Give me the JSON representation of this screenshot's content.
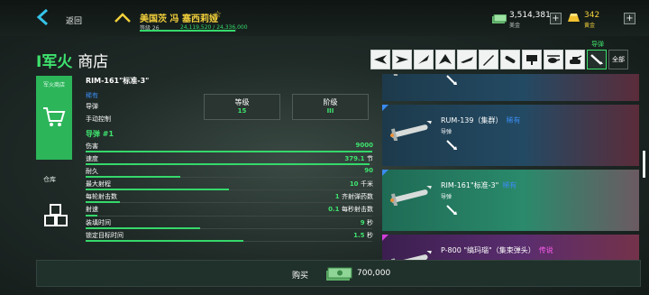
{
  "topbar": {
    "back_label": "返回",
    "player_name": "美国茨 冯 塞西莉娅",
    "level_label": "等级 26",
    "xp_text": "24,119,520 / 24,336,000",
    "xp_progress": 0.991,
    "cash_value": "3,514,381",
    "cash_label": "美金",
    "gold_value": "342",
    "gold_label": "黄金",
    "plus_label": "+"
  },
  "page": {
    "title_accent": "I军火",
    "title_main": "商店"
  },
  "categories": {
    "active_label": "导弹",
    "all_label": "全部",
    "icons": [
      "fighter-jet-icon",
      "strike-jet-icon",
      "interceptor-icon",
      "stealth-jet-icon",
      "bomber-icon",
      "rocket-icon",
      "missile-icon",
      "radar-icon",
      "helicopter-icon",
      "tank-icon",
      "missile-selected-icon"
    ]
  },
  "side_nav": {
    "shop_label": "军火商店",
    "store_label": "仓库"
  },
  "detail": {
    "item_name": "RIM-161\"标准-3\"",
    "rarity": "稀有",
    "type": "导弹",
    "control": "手动控制",
    "guided_label": "导弹 #1",
    "level_label": "等级",
    "level_value": "15",
    "tier_label": "阶级",
    "tier_value": "III"
  },
  "stats": [
    {
      "name": "伤害",
      "value": "9000",
      "unit": "",
      "level": 1.0
    },
    {
      "name": "速度",
      "value": "379.1",
      "unit": "节",
      "level": 0.99
    },
    {
      "name": "耐久",
      "value": "90",
      "unit": "",
      "level": 0.33
    },
    {
      "name": "最大射程",
      "value": "10",
      "unit": "千米",
      "level": 0.5
    },
    {
      "name": "每轮射击数",
      "value": "1",
      "unit": "齐射弹药数",
      "level": 0.12
    },
    {
      "name": "射速",
      "value": "0.1",
      "unit": "每秒射击数",
      "level": 0.04
    },
    {
      "name": "装填时间",
      "value": "9",
      "unit": "秒",
      "level": 0.4
    },
    {
      "name": "锁定目标时间",
      "value": "1.5",
      "unit": "秒",
      "level": 0.55
    }
  ],
  "list": [
    {
      "name": "",
      "rarity": "",
      "type": "",
      "variant": "partial"
    },
    {
      "name": "RUM-139（集群）",
      "rarity": "稀有",
      "type": "导弹",
      "variant": "normal"
    },
    {
      "name": "RIM-161\"标准-3\"",
      "rarity": "稀有",
      "type": "导弹",
      "variant": "selected"
    },
    {
      "name": "P-800 \"缟玛瑙\"（集束弹头）",
      "rarity": "传说",
      "type": "",
      "variant": "legend"
    }
  ],
  "buy": {
    "label": "购买",
    "price": "700,000"
  },
  "colors": {
    "accent_green": "#3fe36e",
    "rare_blue": "#3b8bf0",
    "legend_pink": "#ff5cf0",
    "gold": "#f2d03b"
  }
}
